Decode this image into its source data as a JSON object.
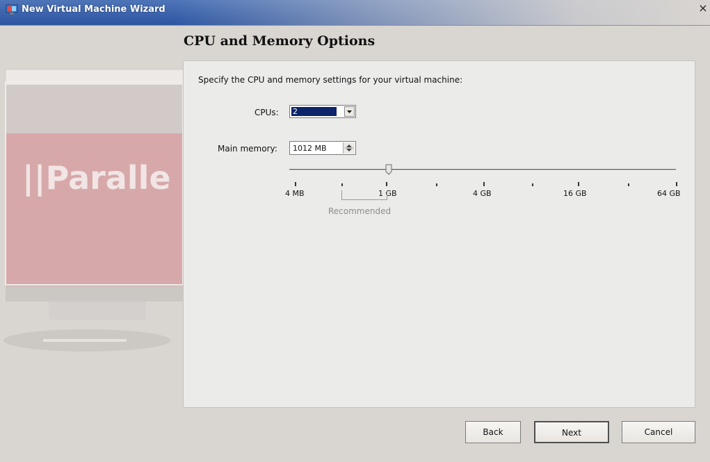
{
  "window": {
    "title": "New Virtual Machine Wizard",
    "close_glyph": "×",
    "icon": "parallels-app-icon"
  },
  "page": {
    "title": "CPU and Memory Options",
    "instruction": "Specify the CPU and memory settings for your virtual machine:"
  },
  "branding": {
    "logo_text": "||Paralle",
    "accent_color": "#d7a8a9"
  },
  "cpu": {
    "label": "CPUs:",
    "value": "2"
  },
  "memory": {
    "label": "Main memory:",
    "value": "1012 MB",
    "slider_value_mb": 1012,
    "ticks": [
      "4 MB",
      "1 GB",
      "4 GB",
      "16 GB",
      "64 GB"
    ],
    "recommended_label": "Recommended"
  },
  "buttons": {
    "back": "Back",
    "next": "Next",
    "cancel": "Cancel"
  },
  "colors": {
    "titlebar": "#3f66ae",
    "selection": "#0b246a",
    "panel": "#ebebea",
    "window": "#d9d5d1"
  }
}
